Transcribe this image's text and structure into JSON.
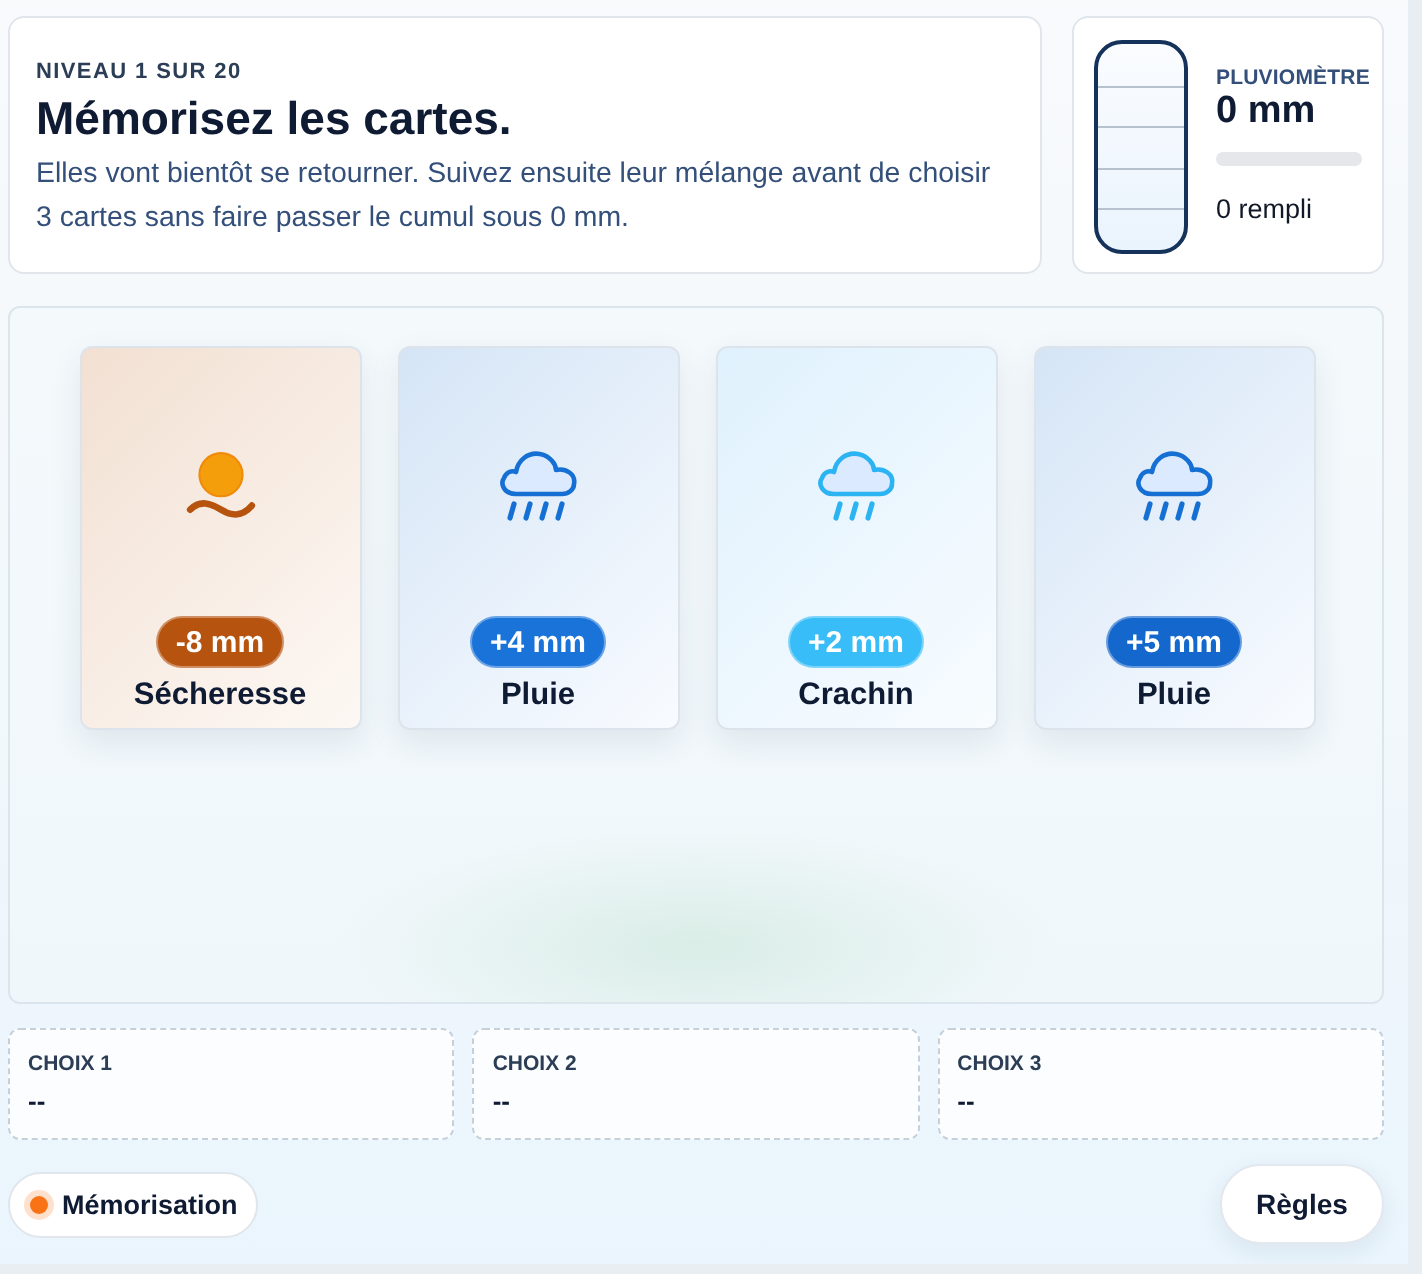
{
  "header": {
    "level_label": "NIVEAU 1 SUR 20",
    "title": "Mémorisez les cartes.",
    "description": "Elles vont bientôt se retourner. Suivez ensuite leur mélange avant de choisir 3 cartes sans faire passer le cumul sous 0 mm."
  },
  "gauge": {
    "label": "PLUVIOMÈTRE",
    "total": "0 mm",
    "level": 0,
    "fill_text": "0 rempli"
  },
  "cards": [
    {
      "kind": "drought",
      "badge": "-8 mm",
      "name": "Sécheresse",
      "color": "#b5530f"
    },
    {
      "kind": "rain",
      "badge": "+4 mm",
      "name": "Pluie",
      "color": "#1a73d9"
    },
    {
      "kind": "drizzle",
      "badge": "+2 mm",
      "name": "Crachin",
      "color": "#38bdf8"
    },
    {
      "kind": "rain",
      "badge": "+5 mm",
      "name": "Pluie",
      "color": "#1467cc"
    }
  ],
  "choices": [
    {
      "label": "CHOIX 1",
      "value": "--"
    },
    {
      "label": "CHOIX 2",
      "value": "--"
    },
    {
      "label": "CHOIX 3",
      "value": "--"
    }
  ],
  "status": {
    "label": "Mémorisation",
    "color": "#f97316"
  },
  "rules_button": "Règles"
}
